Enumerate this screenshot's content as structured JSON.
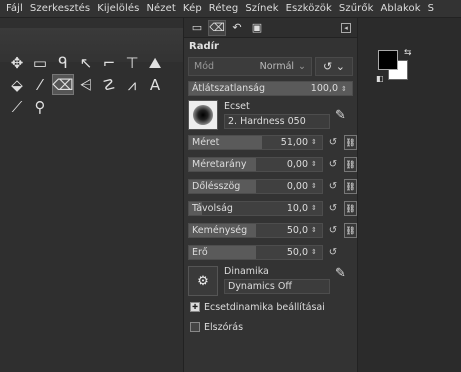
{
  "menubar": [
    "Fájl",
    "Szerkesztés",
    "Kijelölés",
    "Nézet",
    "Kép",
    "Réteg",
    "Színek",
    "Eszközök",
    "Szűrők",
    "Ablakok",
    "S"
  ],
  "tools": [
    {
      "name": "move-icon",
      "glyph": "✥"
    },
    {
      "name": "rect-select-icon",
      "glyph": "▭"
    },
    {
      "name": "lasso-icon",
      "glyph": "ᑫ"
    },
    {
      "name": "fuzzy-select-icon",
      "glyph": "↖"
    },
    {
      "name": "crop-icon",
      "glyph": "⌐"
    },
    {
      "name": "unified-transform-icon",
      "glyph": "⊤"
    },
    {
      "name": "warp-icon",
      "glyph": "⛰"
    },
    {
      "name": "bucket-fill-icon",
      "glyph": "⬙"
    },
    {
      "name": "paintbrush-icon",
      "glyph": "⁄"
    },
    {
      "name": "eraser-icon",
      "glyph": "⌫"
    },
    {
      "name": "clone-icon",
      "glyph": "⩤"
    },
    {
      "name": "smudge-icon",
      "glyph": "☡"
    },
    {
      "name": "paths-icon",
      "glyph": "⩘"
    },
    {
      "name": "text-tool-icon",
      "glyph": "A"
    },
    {
      "name": "color-picker-icon",
      "glyph": "⟋"
    },
    {
      "name": "zoom-icon",
      "glyph": "⚲"
    }
  ],
  "active_tool_index": 9,
  "dock": {
    "title": "Radír",
    "mode_label": "Mód",
    "mode_value": "Normál",
    "opacity": {
      "label": "Átlátszatlanság",
      "value": "100,0",
      "fraction": 1.0
    },
    "brush_caption": "Ecset",
    "brush_name": "2. Hardness 050",
    "props": [
      {
        "label": "Méret",
        "value": "51,00",
        "fraction": 0.55,
        "link": true
      },
      {
        "label": "Méretarány",
        "value": "0,00",
        "fraction": 0.5,
        "link": true
      },
      {
        "label": "Dőlésszög",
        "value": "0,00",
        "fraction": 0.5,
        "link": true
      },
      {
        "label": "Távolság",
        "value": "10,0",
        "fraction": 0.1,
        "link": true
      },
      {
        "label": "Keménység",
        "value": "50,0",
        "fraction": 0.5,
        "link": true
      },
      {
        "label": "Erő",
        "value": "50,0",
        "fraction": 0.5,
        "link": false
      }
    ],
    "dyn_caption": "Dinamika",
    "dyn_name": "Dynamics Off",
    "dyn_settings_label": "Ecsetdinamika beállításai",
    "scatter_label": "Elszórás"
  }
}
